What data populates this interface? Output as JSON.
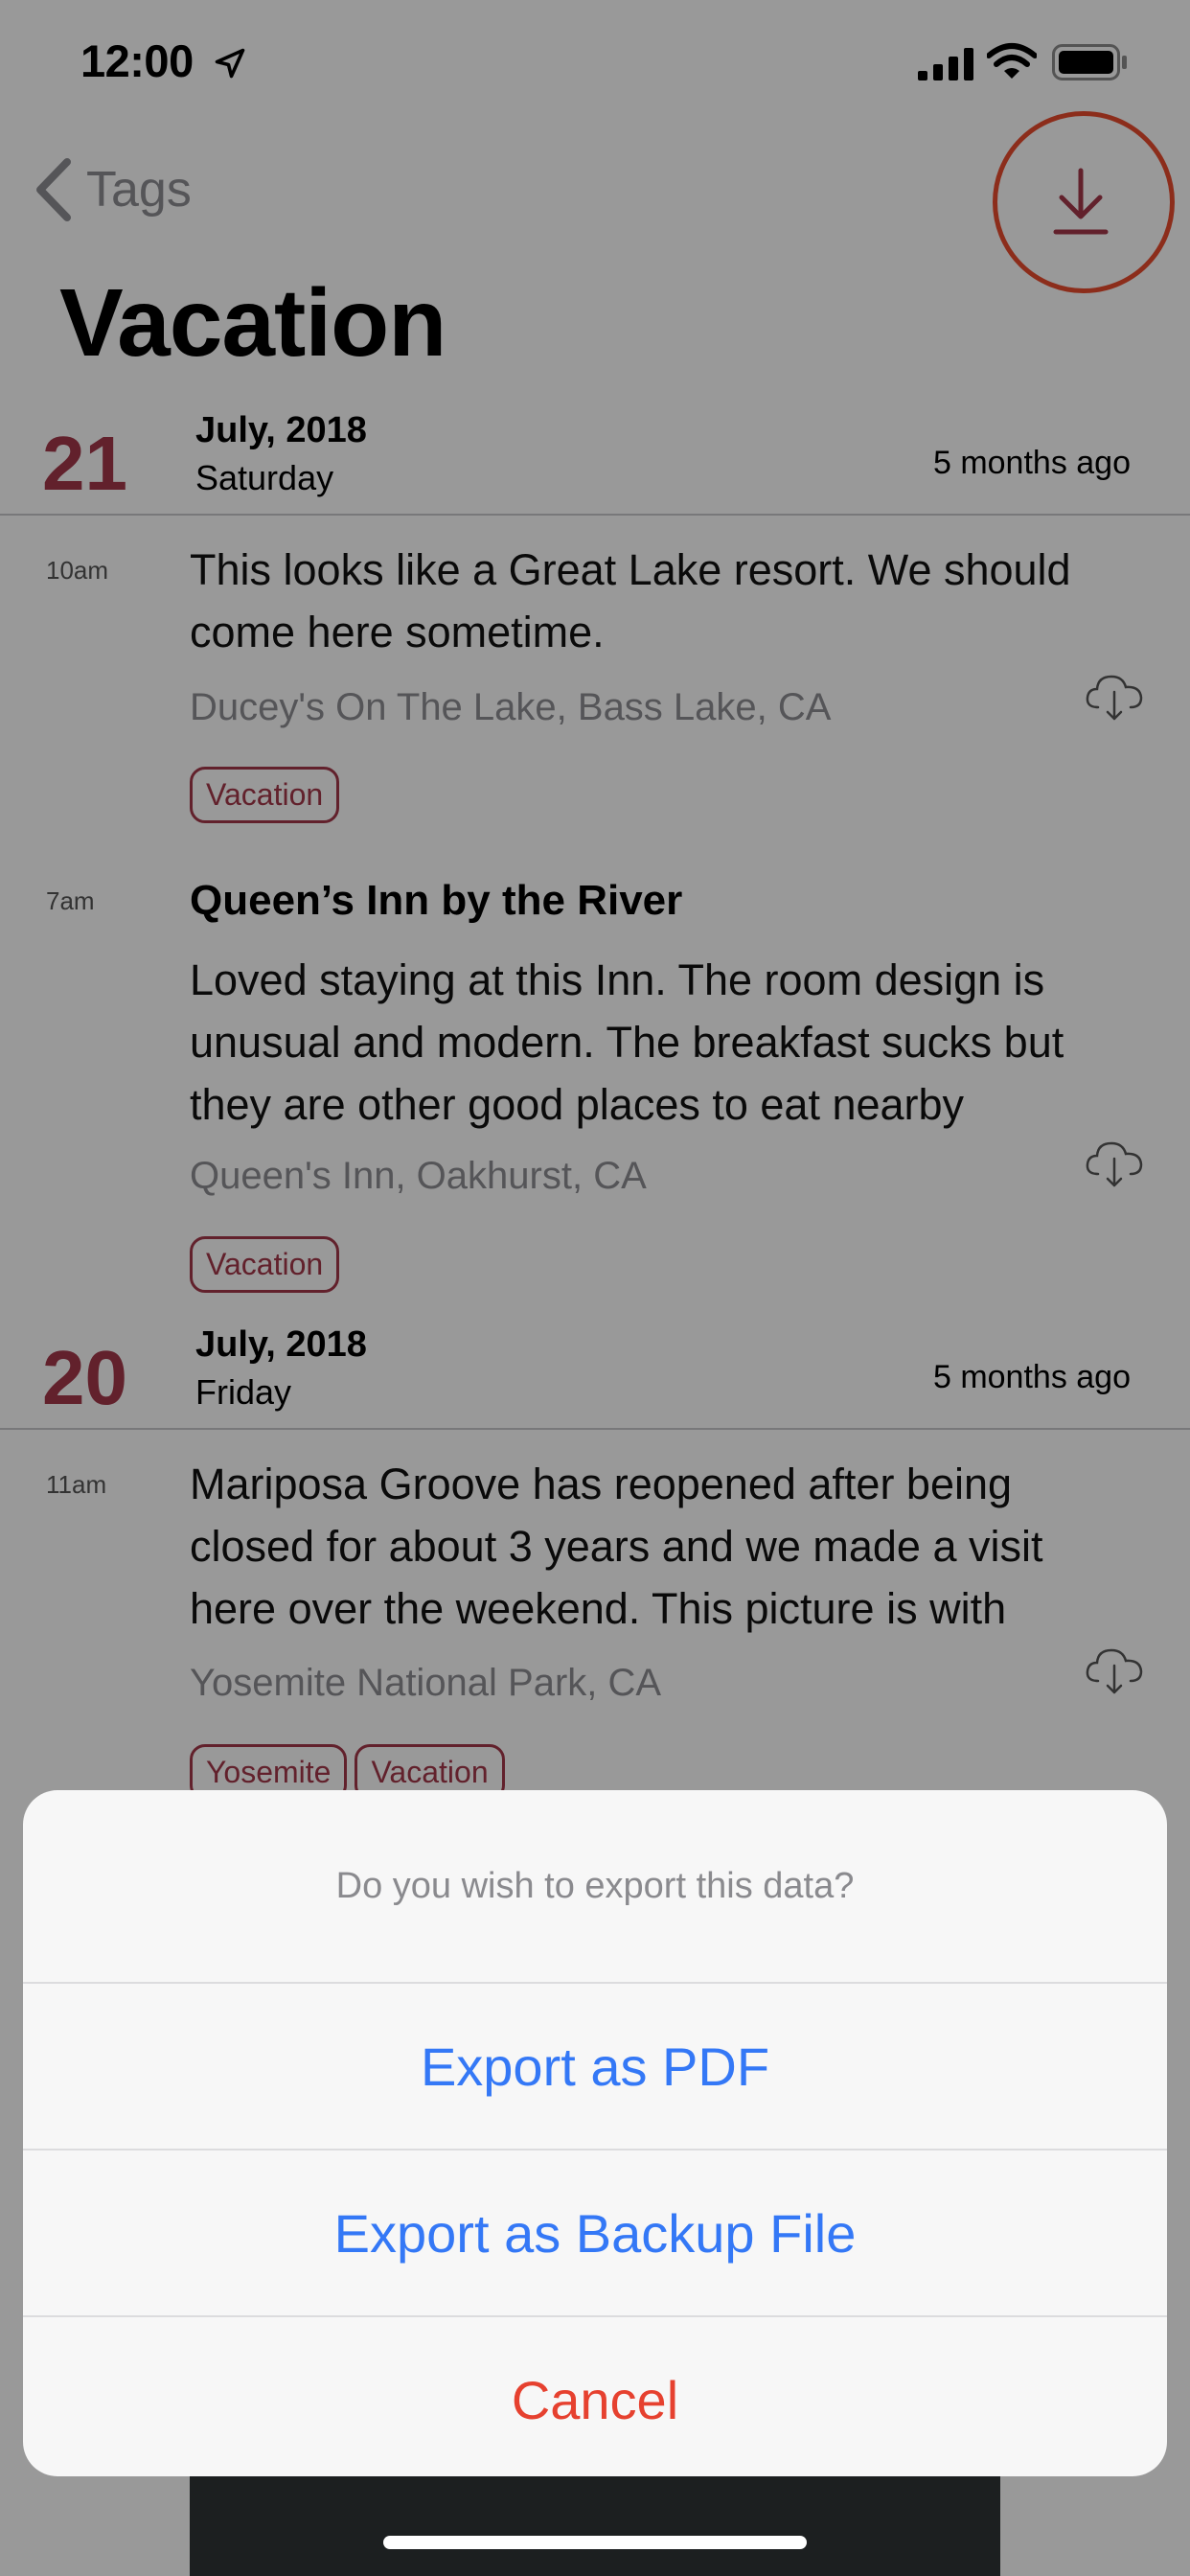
{
  "status_bar": {
    "time": "12:00",
    "icons": [
      "location-arrow-icon",
      "cellular-signal-icon",
      "wifi-icon",
      "battery-icon"
    ]
  },
  "nav": {
    "back_label": "Tags",
    "download_icon": "download-icon"
  },
  "page_title": "Vacation",
  "colors": {
    "accent_red": "#a3384a",
    "highlight_ring": "#e94b2e",
    "action_blue": "#3478f6",
    "destructive_red": "#e6412f"
  },
  "days": [
    {
      "day": "21",
      "month_year": "July, 2018",
      "weekday": "Saturday",
      "relative": "5 months ago",
      "entries": [
        {
          "time": "10am",
          "title": "",
          "body": "This looks like a Great Lake resort. We should come here sometime.",
          "location": "Ducey's On The Lake, Bass Lake, CA",
          "tags": [
            "Vacation"
          ]
        },
        {
          "time": "7am",
          "title": "Queen’s Inn by the River",
          "body": "Loved staying at this Inn. The room design is unusual and modern. The breakfast sucks but they are other good places to eat nearby",
          "location": "Queen's Inn, Oakhurst, CA",
          "tags": [
            "Vacation"
          ]
        }
      ]
    },
    {
      "day": "20",
      "month_year": "July, 2018",
      "weekday": "Friday",
      "relative": "5 months ago",
      "entries": [
        {
          "time": "11am",
          "title": "",
          "body": "Mariposa Groove has reopened after being closed for about 3 years and we made a visit here over the weekend. This picture is with",
          "location": "Yosemite National Park, CA",
          "tags": [
            "Yosemite",
            "Vacation"
          ]
        }
      ]
    }
  ],
  "action_sheet": {
    "message": "Do you wish to export this data?",
    "options": [
      "Export as PDF",
      "Export as Backup File"
    ],
    "cancel": "Cancel"
  }
}
